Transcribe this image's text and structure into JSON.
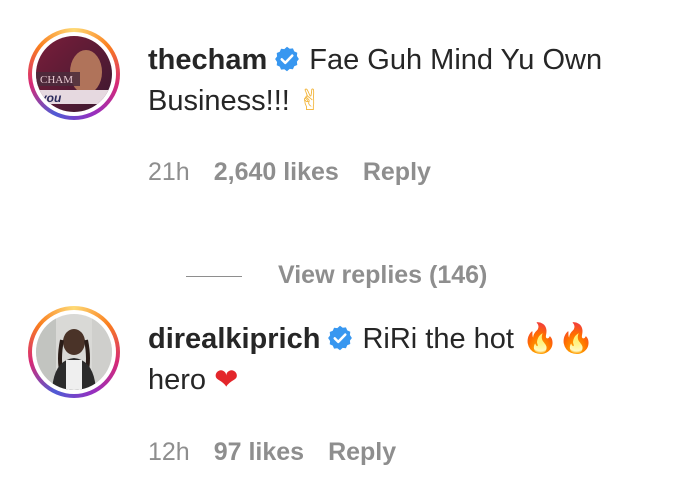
{
  "comments": [
    {
      "username": "thecham",
      "verified": true,
      "text": "Fae Guh Mind Yu Own Business!!!",
      "emoji": "✌",
      "time": "21h",
      "likes": "2,640 likes",
      "reply_label": "Reply",
      "avatar_text": "CHAM",
      "avatar_banner": "you"
    },
    {
      "username": "direalkiprich",
      "verified": true,
      "text": "RiRi the hot",
      "emoji": "🔥🔥",
      "text2": "hero",
      "emoji2": "❤",
      "time": "12h",
      "likes": "97 likes",
      "reply_label": "Reply"
    }
  ],
  "view_replies_label": "View replies (146)",
  "colors": {
    "text": "#262626",
    "muted": "#8e8e8e",
    "verified_badge": "#3897f0"
  }
}
